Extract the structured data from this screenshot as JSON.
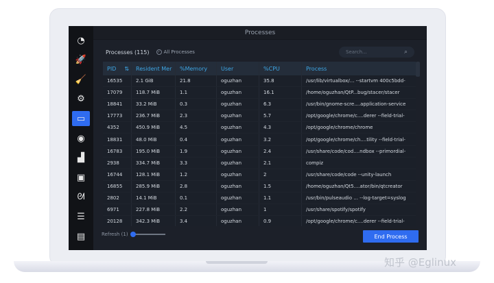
{
  "window": {
    "title": "Processes"
  },
  "toolbar": {
    "count_label": "Processes (115)",
    "all_processes_label": "All Processes",
    "all_processes_checked": true,
    "search_placeholder": "Search..."
  },
  "sidebar": {
    "items": [
      {
        "icon": "dashboard-gauge-icon",
        "glyph": "◔"
      },
      {
        "icon": "rocket-startup-icon",
        "glyph": "🚀"
      },
      {
        "icon": "broom-cleaner-icon",
        "glyph": "🧹"
      },
      {
        "icon": "gears-services-icon",
        "glyph": "⚙"
      },
      {
        "icon": "processes-icon",
        "glyph": "▭",
        "active": true
      },
      {
        "icon": "uninstaller-icon",
        "glyph": "◉"
      },
      {
        "icon": "resources-chart-icon",
        "glyph": "▟"
      },
      {
        "icon": "apt-package-icon",
        "glyph": "▣"
      },
      {
        "icon": "gnome-settings-icon",
        "glyph": "ᘛ"
      },
      {
        "icon": "settings-sliders-icon",
        "glyph": "☰"
      },
      {
        "icon": "feedback-message-icon",
        "glyph": "▤"
      }
    ]
  },
  "table": {
    "columns": [
      "PID",
      "Resident Mer",
      "%Memory",
      "User",
      "%CPU",
      "Process"
    ],
    "sort_icon": "sort-descending-icon",
    "rows": [
      [
        "16535",
        "2.1 GiB",
        "21.8",
        "oguzhan",
        "35.8",
        "/usr/lib/virtualbox/... --startvm 400c5bdd-"
      ],
      [
        "17079",
        "118.7 MiB",
        "1.1",
        "oguzhan",
        "16.1",
        "/home/oguzhan/QtP...bug/stacer/stacer"
      ],
      [
        "18841",
        "33.2 MiB",
        "0.3",
        "oguzhan",
        "6.3",
        "/usr/bin/gnome-scre....application-service"
      ],
      [
        "17773",
        "236.7 MiB",
        "2.3",
        "oguzhan",
        "5.7",
        "/opt/google/chrome/c....derer --field-trial-"
      ],
      [
        "4352",
        "450.9 MiB",
        "4.5",
        "oguzhan",
        "4.3",
        "/opt/google/chrome/chrome"
      ],
      [
        "18831",
        "48.0 MiB",
        "0.4",
        "oguzhan",
        "3.2",
        "/opt/google/chrome/ch....tility --field-trial-"
      ],
      [
        "16783",
        "195.0 MiB",
        "1.9",
        "oguzhan",
        "2.4",
        "/usr/share/code/cod....ndbox --primordial-"
      ],
      [
        "2938",
        "334.7 MiB",
        "3.3",
        "oguzhan",
        "2.1",
        "compiz"
      ],
      [
        "16744",
        "128.1 MiB",
        "1.2",
        "oguzhan",
        "2",
        "/usr/share/code/code --unity-launch"
      ],
      [
        "16855",
        "285.9 MiB",
        "2.8",
        "oguzhan",
        "1.5",
        "/home/oguzhan/Qt5....ator/bin/qtcreator"
      ],
      [
        "2802",
        "14.1 MiB",
        "0.1",
        "oguzhan",
        "1.1",
        "/usr/bin/pulseaudio ... --log-target=syslog"
      ],
      [
        "6971",
        "227.8 MiB",
        "2.2",
        "oguzhan",
        "1",
        "/usr/share/spotify/spotify"
      ],
      [
        "20128",
        "342.3 MiB",
        "3.4",
        "oguzhan",
        "0.9",
        "/opt/google/chrome/c....derer --field-trial-"
      ]
    ]
  },
  "footer": {
    "refresh_label": "Refresh (1)",
    "refresh_value": 1,
    "end_process_label": "End Process"
  },
  "colors": {
    "accent": "#2f6cf0",
    "header_text": "#3ea7e6"
  },
  "watermark": "知乎 @Eglinux"
}
